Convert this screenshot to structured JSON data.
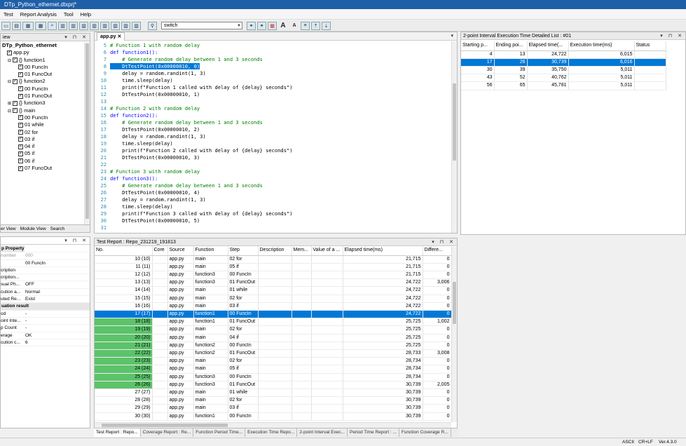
{
  "window": {
    "title": "DTp_Python_ethernet.dtxprj*"
  },
  "menu": [
    "Test",
    "Report Analysis",
    "Tool",
    "Help"
  ],
  "toolbar": {
    "combo_value": "switch",
    "text_a_big": "A",
    "text_a_small": "A"
  },
  "left_tree": {
    "header": "iew",
    "root": "DTp_Python_ethernet",
    "items": [
      {
        "indent": 0,
        "exp": "",
        "label": "app.py",
        "icon": "file-icon"
      },
      {
        "indent": 1,
        "exp": "⊟",
        "label": "{} function1",
        "icon": "braces-icon"
      },
      {
        "indent": 2,
        "exp": "",
        "label": "00 FuncIn",
        "icon": "flag-icon"
      },
      {
        "indent": 2,
        "exp": "",
        "label": "01 FuncOut",
        "icon": "flag-icon"
      },
      {
        "indent": 1,
        "exp": "⊟",
        "label": "{} function2",
        "icon": "braces-icon"
      },
      {
        "indent": 2,
        "exp": "",
        "label": "00 FuncIn",
        "icon": "flag-icon"
      },
      {
        "indent": 2,
        "exp": "",
        "label": "01 FuncOut",
        "icon": "flag-icon"
      },
      {
        "indent": 1,
        "exp": "⊞",
        "label": "{} function3",
        "icon": "braces-icon"
      },
      {
        "indent": 1,
        "exp": "⊟",
        "label": "{} main",
        "icon": "braces-icon"
      },
      {
        "indent": 2,
        "exp": "",
        "label": "00 FuncIn",
        "icon": "flag-icon"
      },
      {
        "indent": 2,
        "exp": "",
        "label": "01 while",
        "icon": "flag-icon"
      },
      {
        "indent": 2,
        "exp": "",
        "label": "02 for",
        "icon": "flag-icon"
      },
      {
        "indent": 2,
        "exp": "",
        "label": "03 if",
        "icon": "flag-icon"
      },
      {
        "indent": 2,
        "exp": "",
        "label": "04 if",
        "icon": "flag-icon"
      },
      {
        "indent": 2,
        "exp": "",
        "label": "05 if",
        "icon": "flag-icon"
      },
      {
        "indent": 2,
        "exp": "",
        "label": "06 if",
        "icon": "circle-icon"
      },
      {
        "indent": 2,
        "exp": "",
        "label": "07 FuncOut",
        "icon": "circle-icon"
      }
    ],
    "tabs": [
      "er View",
      "Module View",
      "Search"
    ]
  },
  "property": {
    "header": "p Property",
    "rows": [
      {
        "k": "number",
        "v": "000",
        "sec": false,
        "grey": true
      },
      {
        "k": "",
        "v": "00 FuncIn",
        "sec": false
      },
      {
        "k": "cription",
        "v": "",
        "sec": false
      },
      {
        "k": "cription...",
        "v": "",
        "sec": false
      },
      {
        "k": "sual Ph...",
        "v": "OFF",
        "sec": false
      },
      {
        "k": "cution a...",
        "v": "Normal",
        "sec": false
      },
      {
        "k": "uted Re...",
        "v": "Exist",
        "sec": false
      },
      {
        "k": "uation result",
        "v": "",
        "sec": true
      },
      {
        "k": "od",
        "v": "-",
        "sec": false
      },
      {
        "k": "oint Inte...",
        "v": "-",
        "sec": false
      },
      {
        "k": "p Count",
        "v": "-",
        "sec": false
      },
      {
        "k": "erage",
        "v": "OK",
        "sec": false
      },
      {
        "k": "cution c...",
        "v": "6",
        "sec": false
      }
    ]
  },
  "editor": {
    "tab": "app.py",
    "lines": [
      {
        "n": "5",
        "t": "# Function 1 with random delay",
        "c": "cm"
      },
      {
        "n": "6",
        "t": "def function1():",
        "c": "kw"
      },
      {
        "n": "7",
        "t": "    # Generate random delay between 1 and 3 seconds",
        "c": "cm"
      },
      {
        "n": "8",
        "t": "    DtTestPoint(0x00000010, 0)",
        "c": "hl"
      },
      {
        "n": "9",
        "t": "    delay = random.randint(1, 3)",
        "c": ""
      },
      {
        "n": "10",
        "t": "    time.sleep(delay)",
        "c": ""
      },
      {
        "n": "11",
        "t": "    print(f\"Function 1 called with delay of {delay} seconds\")",
        "c": ""
      },
      {
        "n": "12",
        "t": "    DtTestPoint(0x00000010, 1)",
        "c": ""
      },
      {
        "n": "13",
        "t": "",
        "c": ""
      },
      {
        "n": "14",
        "t": "# Function 2 with random delay",
        "c": "cm"
      },
      {
        "n": "15",
        "t": "def function2():",
        "c": "kw"
      },
      {
        "n": "16",
        "t": "    # Generate random delay between 1 and 3 seconds",
        "c": "cm"
      },
      {
        "n": "17",
        "t": "    DtTestPoint(0x00000010, 2)",
        "c": ""
      },
      {
        "n": "18",
        "t": "    delay = random.randint(1, 3)",
        "c": ""
      },
      {
        "n": "19",
        "t": "    time.sleep(delay)",
        "c": ""
      },
      {
        "n": "20",
        "t": "    print(f\"Function 2 called with delay of {delay} seconds\")",
        "c": ""
      },
      {
        "n": "21",
        "t": "    DtTestPoint(0x00000010, 3)",
        "c": ""
      },
      {
        "n": "22",
        "t": "",
        "c": ""
      },
      {
        "n": "23",
        "t": "# Function 3 with random delay",
        "c": "cm"
      },
      {
        "n": "24",
        "t": "def function3():",
        "c": "kw"
      },
      {
        "n": "25",
        "t": "    # Generate random delay between 1 and 3 seconds",
        "c": "cm"
      },
      {
        "n": "26",
        "t": "    DtTestPoint(0x00000010, 4)",
        "c": ""
      },
      {
        "n": "27",
        "t": "    delay = random.randint(1, 3)",
        "c": ""
      },
      {
        "n": "28",
        "t": "    time.sleep(delay)",
        "c": ""
      },
      {
        "n": "29",
        "t": "    print(f\"Function 3 called with delay of {delay} seconds\")",
        "c": ""
      },
      {
        "n": "30",
        "t": "    DtTestPoint(0x00000010, 5)",
        "c": ""
      },
      {
        "n": "31",
        "t": "",
        "c": ""
      }
    ]
  },
  "interval": {
    "header": "2-point Interval Execution Time Detailed List : #01",
    "cols": [
      "Starting p...",
      "Ending poi...",
      "Elapsed time(...",
      "Execution time(ms)",
      "Status"
    ],
    "rows": [
      [
        "4",
        "13",
        "24,722",
        "6,015",
        ""
      ],
      [
        "17",
        "26",
        "30,739",
        "6,016",
        ""
      ],
      [
        "30",
        "39",
        "35,750",
        "5,011",
        ""
      ],
      [
        "43",
        "52",
        "40,762",
        "5,011",
        ""
      ],
      [
        "56",
        "65",
        "45,781",
        "5,011",
        ""
      ]
    ],
    "selected": 1
  },
  "report": {
    "header": "Test Report : Repo_231219_191813",
    "cols": [
      "No.",
      "Core",
      "Source",
      "Function",
      "Step",
      "Description",
      "Mem...",
      "Value of a ...",
      "Elapsed time(ms)",
      "Differe..."
    ],
    "rows": [
      [
        "10 (10)",
        "",
        "app.py",
        "main",
        "02 for",
        "",
        "",
        "",
        "21,715",
        "0"
      ],
      [
        "11 (11)",
        "",
        "app.py",
        "main",
        "05 if",
        "",
        "",
        "",
        "21,715",
        "0"
      ],
      [
        "12 (12)",
        "",
        "app.py",
        "function3",
        "00 FuncIn",
        "",
        "",
        "",
        "21,715",
        "0"
      ],
      [
        "13 (13)",
        "",
        "app.py",
        "function3",
        "01 FuncOut",
        "",
        "",
        "",
        "24,722",
        "3,006"
      ],
      [
        "14 (14)",
        "",
        "app.py",
        "main",
        "01 while",
        "",
        "",
        "",
        "24,722",
        "0"
      ],
      [
        "15 (15)",
        "",
        "app.py",
        "main",
        "02 for",
        "",
        "",
        "",
        "24,722",
        "0"
      ],
      [
        "16 (16)",
        "",
        "app.py",
        "main",
        "03 if",
        "",
        "",
        "",
        "24,722",
        "0"
      ],
      [
        "17 (17)",
        "",
        "app.py",
        "function1",
        "00 FuncIn",
        "",
        "",
        "",
        "24,722",
        "0"
      ],
      [
        "18 (18)",
        "",
        "app.py",
        "function1",
        "01 FuncOut",
        "",
        "",
        "",
        "25,725",
        "1,002"
      ],
      [
        "19 (19)",
        "",
        "app.py",
        "main",
        "02 for",
        "",
        "",
        "",
        "25,725",
        "0"
      ],
      [
        "20 (20)",
        "",
        "app.py",
        "main",
        "04 if",
        "",
        "",
        "",
        "25,725",
        "0"
      ],
      [
        "21 (21)",
        "",
        "app.py",
        "function2",
        "00 FuncIn",
        "",
        "",
        "",
        "25,725",
        "0"
      ],
      [
        "22 (22)",
        "",
        "app.py",
        "function2",
        "01 FuncOut",
        "",
        "",
        "",
        "28,733",
        "3,008"
      ],
      [
        "23 (23)",
        "",
        "app.py",
        "main",
        "02 for",
        "",
        "",
        "",
        "28,734",
        "0"
      ],
      [
        "24 (24)",
        "",
        "app.py",
        "main",
        "05 if",
        "",
        "",
        "",
        "28,734",
        "0"
      ],
      [
        "25 (25)",
        "",
        "app.py",
        "function3",
        "00 FuncIn",
        "",
        "",
        "",
        "28,734",
        "0"
      ],
      [
        "26 (26)",
        "",
        "app.py",
        "function3",
        "01 FuncOut",
        "",
        "",
        "",
        "30,739",
        "2,005"
      ],
      [
        "27 (27)",
        "",
        "app.py",
        "main",
        "01 while",
        "",
        "",
        "",
        "30,739",
        "0"
      ],
      [
        "28 (28)",
        "",
        "app.py",
        "main",
        "02 for",
        "",
        "",
        "",
        "30,739",
        "0"
      ],
      [
        "29 (29)",
        "",
        "app.py",
        "main",
        "03 if",
        "",
        "",
        "",
        "30,739",
        "0"
      ],
      [
        "30 (30)",
        "",
        "app.py",
        "function1",
        "00 FuncIn",
        "",
        "",
        "",
        "30,739",
        "0"
      ]
    ],
    "selected": 7,
    "green_from": 8,
    "green_to": 16
  },
  "bottom_tabs": [
    "Test Report : Repo...",
    "Coverage Report : Re...",
    "Function Period Time...",
    "Execution Time Repo...",
    "2-point Interval Exec...",
    "Period Time Report : ...",
    "Function Coverage R..."
  ],
  "status": {
    "a": "ASCII",
    "b": "CR+LF",
    "c": "Ver.4.3.0"
  },
  "colors": {
    "accent": "#0078d7",
    "green": "#5cc36a",
    "title": "#1f5fa8"
  }
}
